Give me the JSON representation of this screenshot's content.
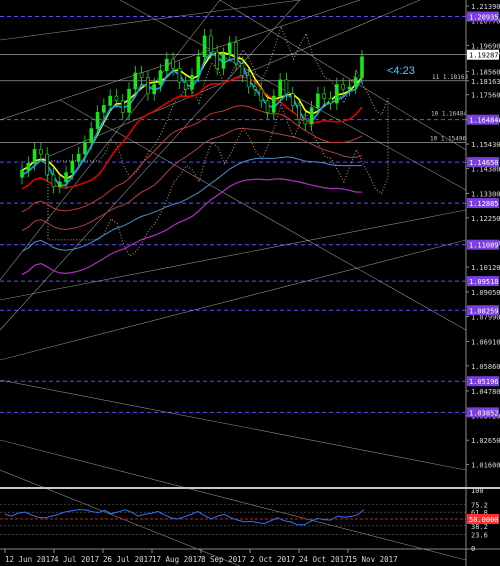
{
  "colors": {
    "background": "#000000",
    "axis_text": "#d8d8d8",
    "level_line": "#5f4bff",
    "level_box": "#7b3fe0",
    "candle": "#19e619",
    "countdown": "#3fd0ff",
    "ma_yellow": "#ffff00",
    "ma_blue": "#1e90ff",
    "ma_red": "#e00000",
    "ma_purple": "#b030c0",
    "cloud": "#c8a078",
    "rsi_line": "#3070ff",
    "rsi_level": "#ff3030"
  },
  "countdown": "<4:23",
  "current_price": "1.19287",
  "annotations": [
    {
      "text": "11 1.18163"
    },
    {
      "text": "10 1.16484"
    },
    {
      "text": "10 1.15496"
    }
  ],
  "chart_data": {
    "type": "line",
    "title": "",
    "ylim": [
      1.00675,
      1.2139
    ],
    "price_ticks": [
      "1.21390",
      "1.20770",
      "1.19690",
      "1.19287",
      "1.18560",
      "1.18163",
      "1.17560",
      "1.16484",
      "1.16470",
      "1.15430",
      "1.14380",
      "1.13300",
      "1.12250",
      "1.11180",
      "1.10120",
      "1.09050",
      "1.07990",
      "1.06910",
      "1.05860",
      "1.04780",
      "1.03720",
      "1.02650",
      "1.01600"
    ],
    "level_lines": [
      {
        "price": 1.20935,
        "label": "1.20935"
      },
      {
        "price": 1.16484,
        "label": "1.16484"
      },
      {
        "price": 1.1465,
        "label": "1.14650"
      },
      {
        "price": 1.12885,
        "label": "1.12885"
      },
      {
        "price": 1.11089,
        "label": "1.11089"
      },
      {
        "price": 1.09518,
        "label": "1.09518"
      },
      {
        "price": 1.08259,
        "label": "1.08259"
      },
      {
        "price": 1.05196,
        "label": "1.05196"
      },
      {
        "price": 1.03852,
        "label": "1.03852"
      }
    ],
    "x_labels": [
      "12 Jun 2017",
      "4 Jul 2017",
      "26 Jul 2017",
      "17 Aug 2017",
      "8 Sep 2017",
      "2 Oct 2017",
      "24 Oct 2017",
      "15 Nov 2017"
    ],
    "close_series": [
      1.143,
      1.146,
      1.152,
      1.15,
      1.141,
      1.136,
      1.138,
      1.142,
      1.147,
      1.15,
      1.155,
      1.161,
      1.168,
      1.171,
      1.175,
      1.173,
      1.168,
      1.178,
      1.185,
      1.183,
      1.176,
      1.18,
      1.186,
      1.191,
      1.187,
      1.181,
      1.178,
      1.184,
      1.192,
      1.201,
      1.194,
      1.187,
      1.193,
      1.198,
      1.189,
      1.184,
      1.179,
      1.178,
      1.173,
      1.168,
      1.175,
      1.182,
      1.176,
      1.171,
      1.165,
      1.163,
      1.17,
      1.176,
      1.174,
      1.172,
      1.18,
      1.178,
      1.179,
      1.183,
      1.192
    ],
    "rsi": {
      "scale_labels": [
        "100",
        "75.2",
        "61.8",
        "50",
        "38.2",
        "23.6",
        "0"
      ],
      "level": "50.0000",
      "values": [
        58,
        55,
        60,
        62,
        57,
        53,
        52,
        55,
        58,
        62,
        64,
        66,
        66,
        63,
        61,
        65,
        59,
        62,
        66,
        62,
        55,
        58,
        60,
        63,
        57,
        52,
        50,
        54,
        58,
        63,
        56,
        50,
        55,
        58,
        52,
        48,
        45,
        46,
        44,
        42,
        47,
        52,
        47,
        45,
        40,
        40,
        46,
        51,
        49,
        48,
        55,
        53,
        54,
        57,
        66
      ]
    }
  }
}
